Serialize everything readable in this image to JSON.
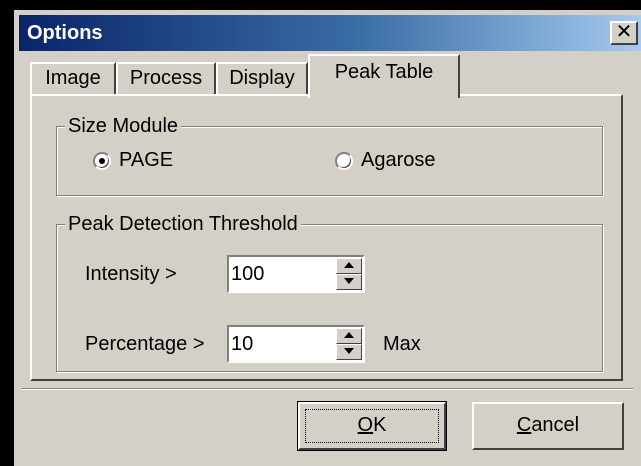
{
  "window": {
    "title": "Options",
    "close_glyph": "✕"
  },
  "tabs": [
    {
      "label": "Image"
    },
    {
      "label": "Process"
    },
    {
      "label": "Display"
    },
    {
      "label": "Peak Table",
      "active": true
    }
  ],
  "size_module": {
    "label": "Size Module",
    "options": [
      {
        "label": "PAGE",
        "checked": true
      },
      {
        "label": "Agarose",
        "checked": false
      }
    ]
  },
  "peak_detection": {
    "label": "Peak Detection Threshold",
    "intensity": {
      "label": "Intensity >",
      "value": "100"
    },
    "percentage": {
      "label": "Percentage >",
      "value": "10",
      "suffix": "Max"
    }
  },
  "buttons": {
    "ok": {
      "mnemonic": "O",
      "rest": "K"
    },
    "cancel": {
      "mnemonic": "C",
      "rest": "ancel"
    }
  }
}
